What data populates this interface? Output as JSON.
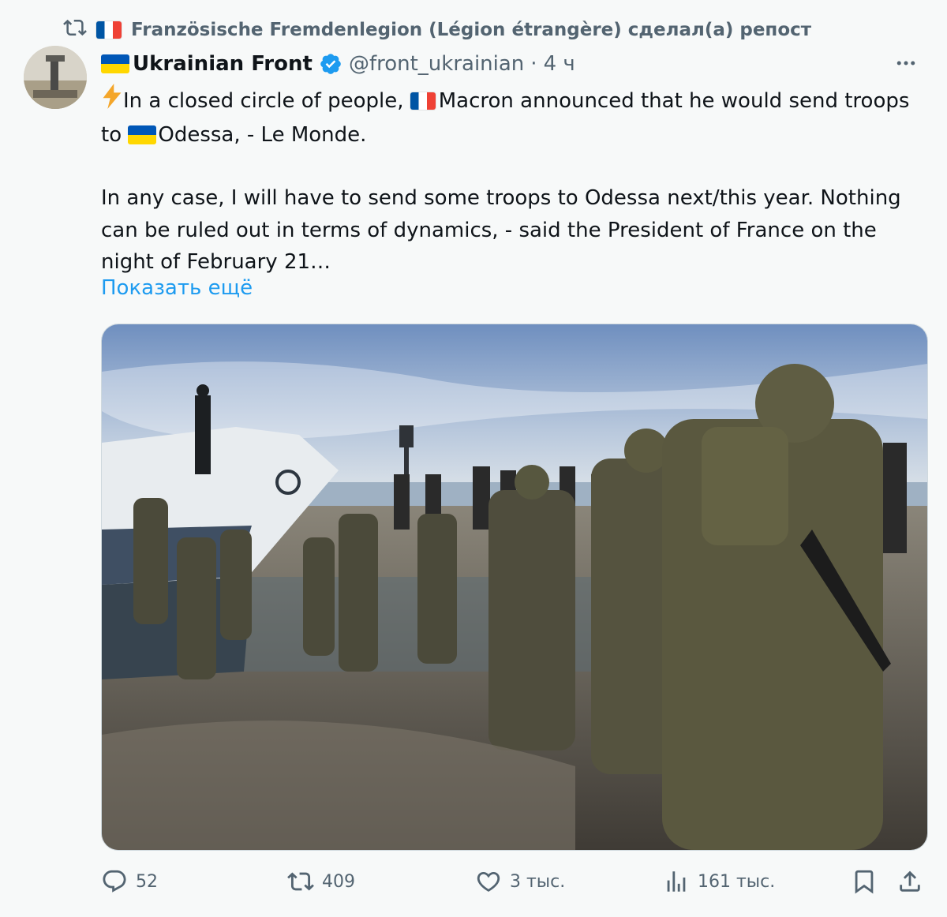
{
  "repost": {
    "icon": "repost-icon",
    "text": "Französische Fremdenlegion (Légion étrangère) сделал(а) репост"
  },
  "author": {
    "name": "Ukrainian Front",
    "handle": "@front_ukrainian",
    "separator": "·",
    "time": "4 ч"
  },
  "tweet": {
    "line1_part1": "In a closed circle of people, ",
    "line1_part2": "Macron announced that he would send troops to ",
    "line1_part3": "Odessa, - Le Monde.",
    "paragraph2": "In any case, I will have to send some troops to Odessa next/this year. Nothing can be ruled out in terms of dynamics, - said the President of France on the night of February 21…",
    "show_more": "Показать ещё"
  },
  "actions": {
    "replies": "52",
    "reposts": "409",
    "likes": "3 тыс.",
    "views": "161 тыс."
  },
  "colors": {
    "accent": "#1d9bf0",
    "muted": "#536471",
    "background": "#f7f9f9"
  }
}
